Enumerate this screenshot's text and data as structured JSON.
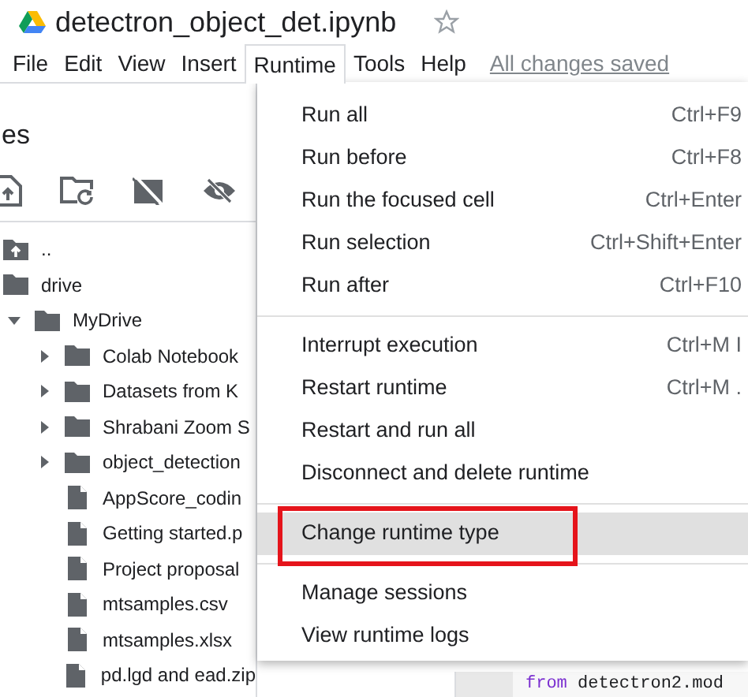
{
  "window": {
    "title": "detectron_object_det.ipynb",
    "starred": false
  },
  "menubar": {
    "items": [
      {
        "label": "File",
        "selected": false
      },
      {
        "label": "Edit",
        "selected": false
      },
      {
        "label": "View",
        "selected": false
      },
      {
        "label": "Insert",
        "selected": false
      },
      {
        "label": "Runtime",
        "selected": true
      },
      {
        "label": "Tools",
        "selected": false
      },
      {
        "label": "Help",
        "selected": false
      }
    ],
    "status": "All changes saved"
  },
  "sidebar": {
    "title": "es",
    "tree": [
      {
        "label": "..",
        "kind": "parent"
      },
      {
        "label": "drive",
        "kind": "folder",
        "children": [
          {
            "label": "MyDrive",
            "kind": "folder",
            "expanded": true,
            "children": [
              {
                "label": "Colab Notebook",
                "kind": "folder",
                "expanded": false
              },
              {
                "label": "Datasets from K",
                "kind": "folder",
                "expanded": false
              },
              {
                "label": "Shrabani Zoom S",
                "kind": "folder",
                "expanded": false
              },
              {
                "label": "object_detection",
                "kind": "folder",
                "expanded": false
              },
              {
                "label": "AppScore_codin",
                "kind": "file"
              },
              {
                "label": "Getting started.p",
                "kind": "file"
              },
              {
                "label": "Project proposal",
                "kind": "file"
              },
              {
                "label": "mtsamples.csv",
                "kind": "file"
              },
              {
                "label": "mtsamples.xlsx",
                "kind": "file"
              },
              {
                "label": "pd.lgd and ead.zip",
                "kind": "file"
              }
            ]
          }
        ]
      }
    ]
  },
  "runtime_menu": {
    "groups": [
      [
        {
          "label": "Run all",
          "shortcut": "Ctrl+F9",
          "selected": false
        },
        {
          "label": "Run before",
          "shortcut": "Ctrl+F8",
          "selected": false
        },
        {
          "label": "Run the focused cell",
          "shortcut": "Ctrl+Enter",
          "selected": false
        },
        {
          "label": "Run selection",
          "shortcut": "Ctrl+Shift+Enter",
          "selected": false
        },
        {
          "label": "Run after",
          "shortcut": "Ctrl+F10",
          "selected": false
        }
      ],
      [
        {
          "label": "Interrupt execution",
          "shortcut": "Ctrl+M I",
          "selected": false
        },
        {
          "label": "Restart runtime",
          "shortcut": "Ctrl+M .",
          "selected": false
        },
        {
          "label": "Restart and run all",
          "selected": false
        },
        {
          "label": "Disconnect and delete runtime",
          "selected": false
        }
      ],
      [
        {
          "label": "Change runtime type",
          "selected": true
        }
      ],
      [
        {
          "label": "Manage sessions",
          "selected": false
        },
        {
          "label": "View runtime logs",
          "selected": false
        }
      ]
    ]
  },
  "code_cell": {
    "keyword": "from",
    "text": "detectron2.mod"
  }
}
